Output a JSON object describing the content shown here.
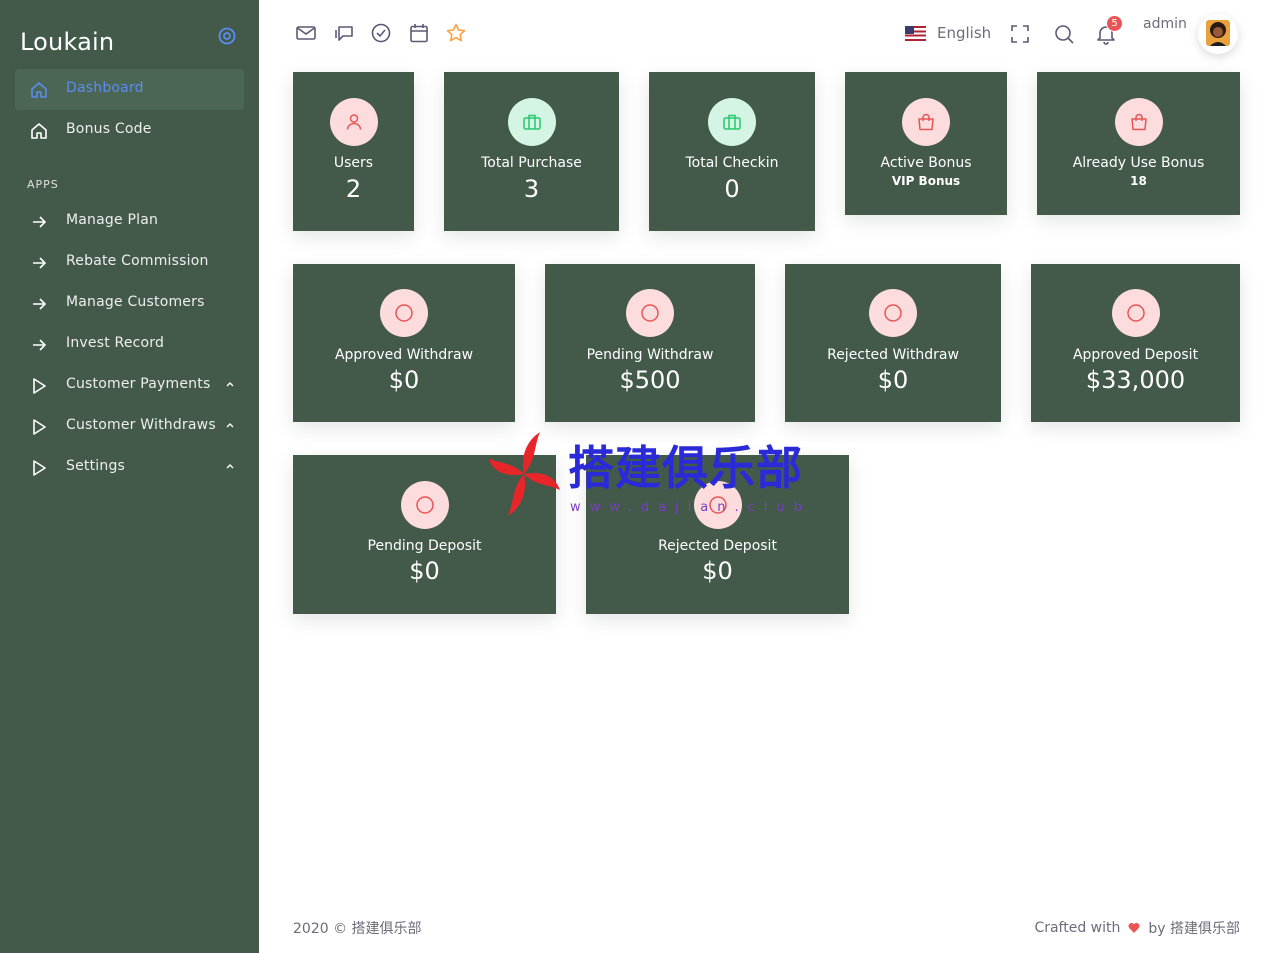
{
  "sidebar": {
    "brand": "Loukain",
    "items": [
      {
        "label": "Dashboard"
      },
      {
        "label": "Bonus Code"
      }
    ],
    "section_label": "APPS",
    "apps": [
      {
        "label": "Manage Plan"
      },
      {
        "label": "Rebate Commission"
      },
      {
        "label": "Manage Customers"
      },
      {
        "label": "Invest Record"
      },
      {
        "label": "Customer Payments"
      },
      {
        "label": "Customer Withdraws"
      },
      {
        "label": "Settings"
      }
    ]
  },
  "topbar": {
    "language": "English",
    "notifications_count": "5",
    "user_name": "admin"
  },
  "stats_row1": [
    {
      "title": "Users",
      "value": "2"
    },
    {
      "title": "Total Purchase",
      "value": "3"
    },
    {
      "title": "Total Checkin",
      "value": "0"
    },
    {
      "title": "Active Bonus",
      "sub": "VIP Bonus"
    },
    {
      "title": "Already Use Bonus",
      "sub": "18"
    }
  ],
  "stats_row2": [
    {
      "title": "Approved Withdraw",
      "value": "$0"
    },
    {
      "title": "Pending Withdraw",
      "value": "$500"
    },
    {
      "title": "Rejected Withdraw",
      "value": "$0"
    },
    {
      "title": "Approved Deposit",
      "value": "$33,000"
    }
  ],
  "stats_row3": [
    {
      "title": "Pending Deposit",
      "value": "$0"
    },
    {
      "title": "Rejected Deposit",
      "value": "$0"
    }
  ],
  "watermark": {
    "title": "搭建俱乐部",
    "url": "www.dajian.club"
  },
  "footer": {
    "copyright": "2020 © 搭建俱乐部",
    "crafted": "Crafted with",
    "by": "by 搭建俱乐部"
  },
  "colors": {
    "sidebar_bg": "#435a4a",
    "card_bg": "#435a4a",
    "active_link": "#5b8cf0",
    "badge_pink": "#fcdcdc",
    "badge_green": "#d5f5e4",
    "danger": "#ea5455",
    "watermark_blue": "#2b2ad8"
  }
}
